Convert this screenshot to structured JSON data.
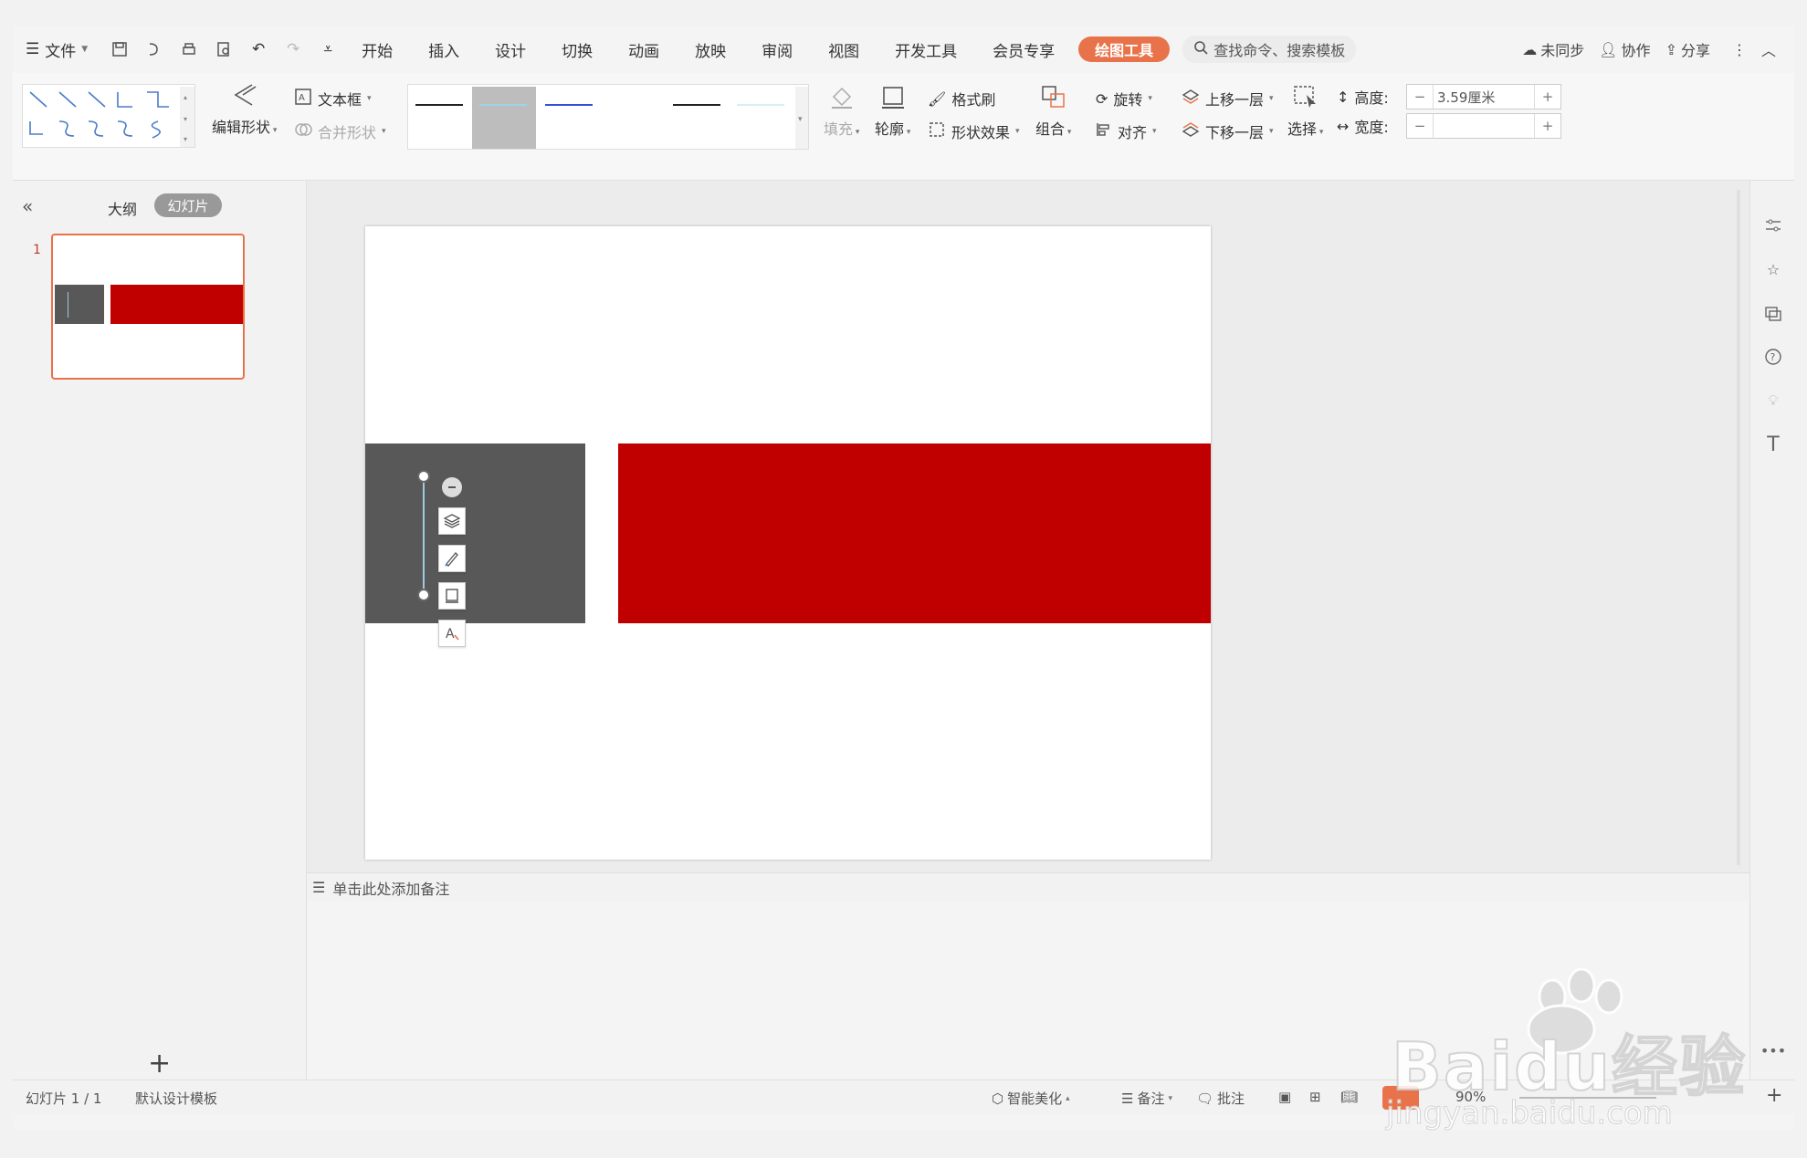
{
  "menubar": {
    "file": "文件",
    "tabs": [
      "开始",
      "插入",
      "设计",
      "切换",
      "动画",
      "放映",
      "审阅",
      "视图",
      "开发工具",
      "会员专享"
    ],
    "active_tab": "绘图工具",
    "search_placeholder": "查找命令、搜索模板",
    "sync": "未同步",
    "collab": "协作",
    "share": "分享"
  },
  "ribbon": {
    "edit_shape": "编辑形状",
    "textbox": "文本框",
    "merge_shape": "合并形状",
    "fill": "填充",
    "outline": "轮廓",
    "format_painter": "格式刷",
    "shape_effect": "形状效果",
    "group": "组合",
    "rotate": "旋转",
    "align": "对齐",
    "bring_forward": "上移一层",
    "send_backward": "下移一层",
    "select": "选择",
    "height_label": "高度:",
    "height_value": "3.59厘米",
    "width_label": "宽度:",
    "width_value": ""
  },
  "leftpanel": {
    "tab_outline": "大纲",
    "tab_slides": "幻灯片",
    "slide_number": "1"
  },
  "notes": {
    "placeholder": "单击此处添加备注"
  },
  "status": {
    "slide_info": "幻灯片 1 / 1",
    "template": "默认设计模板",
    "beautify": "智能美化",
    "notes": "备注",
    "comments": "批注",
    "zoom": "90%"
  },
  "watermark": {
    "brand": "Bai",
    "brand2": "du",
    "brand3": "经验",
    "url": "jingyan.baidu.com"
  },
  "colors": {
    "accent": "#e8734a",
    "red_shape": "#c00000",
    "grey_shape": "#585858"
  }
}
